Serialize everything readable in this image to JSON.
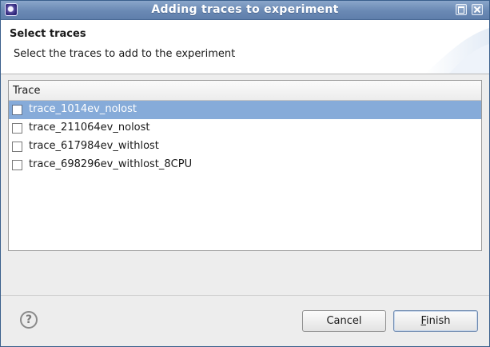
{
  "window": {
    "title": "Adding traces to experiment"
  },
  "header": {
    "title": "Select traces",
    "message": "Select the traces to add to the experiment"
  },
  "table": {
    "column_header": "Trace",
    "rows": [
      {
        "label": "trace_1014ev_nolost",
        "checked": false,
        "selected": true
      },
      {
        "label": "trace_211064ev_nolost",
        "checked": false,
        "selected": false
      },
      {
        "label": "trace_617984ev_withlost",
        "checked": false,
        "selected": false
      },
      {
        "label": "trace_698296ev_withlost_8CPU",
        "checked": false,
        "selected": false
      }
    ]
  },
  "footer": {
    "help_icon": "help-icon",
    "help_glyph": "?",
    "cancel_label": "Cancel",
    "finish_mnemonic": "F",
    "finish_rest": "inish"
  },
  "colors": {
    "titlebar": "#6a89b4",
    "selection": "#86abd9"
  }
}
